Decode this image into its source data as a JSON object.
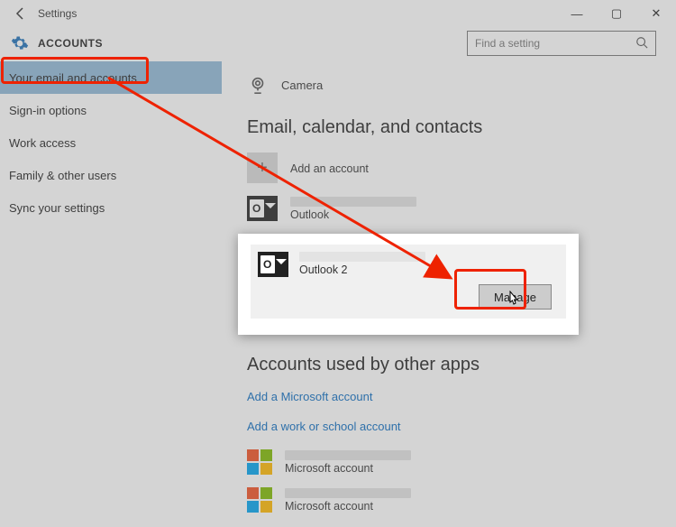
{
  "window": {
    "title": "Settings",
    "minimize": "—",
    "maximize": "▢",
    "close": "✕"
  },
  "header": {
    "section": "ACCOUNTS",
    "search_placeholder": "Find a setting"
  },
  "sidebar": {
    "items": [
      {
        "label": "Your email and accounts",
        "active": true
      },
      {
        "label": "Sign-in options",
        "active": false
      },
      {
        "label": "Work access",
        "active": false
      },
      {
        "label": "Family & other users",
        "active": false
      },
      {
        "label": "Sync your settings",
        "active": false
      }
    ]
  },
  "content": {
    "camera_row": "Camera",
    "section_email_header": "Email, calendar, and contacts",
    "add_account": "Add an account",
    "accounts": [
      {
        "provider": "Outlook"
      },
      {
        "provider": "Outlook 2"
      }
    ],
    "manage_label": "Manage",
    "section_other_header": "Accounts used by other apps",
    "link_ms": "Add a Microsoft account",
    "link_work": "Add a work or school account",
    "ms_accounts": [
      {
        "label": "Microsoft account"
      },
      {
        "label": "Microsoft account"
      }
    ]
  }
}
